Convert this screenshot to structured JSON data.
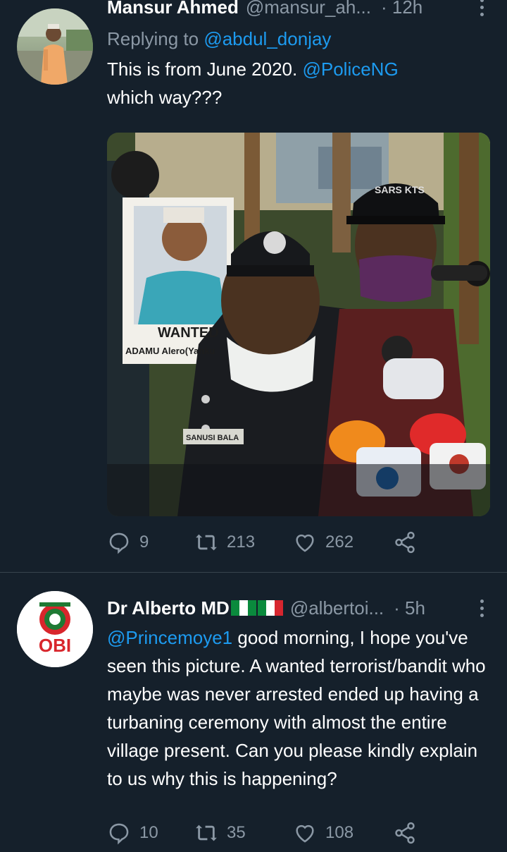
{
  "tweets": [
    {
      "name": "Mansur Ahmed",
      "handle": "@mansur_ah...",
      "time": "· 12h",
      "replying_prefix": "Replying to ",
      "replying_to": "@abdul_donjay",
      "text_before": "This is from June 2020. ",
      "mention": "@PoliceNG",
      "text_after": "which way???",
      "photo_caption_line1": "WANTED",
      "photo_caption_line2": "ADAMU Alero(Yanku",
      "cap_text": "SARS KTS",
      "name_tag": "SANUSI BALA",
      "replies": "9",
      "retweets": "213",
      "likes": "262"
    },
    {
      "name": "Dr Alberto MD",
      "handle": "@albertoi...",
      "time": "· 5h",
      "avatar_text": "OBI",
      "mention": "@Princemoye1",
      "text": " good morning, I hope you've seen this picture. A wanted terrorist/bandit who maybe was never arrested ended up having a turbaning ceremony with almost the entire village present. Can you please kindly explain to us why this is happening?",
      "replies": "10",
      "retweets": "35",
      "likes": "108"
    }
  ],
  "icons": [
    "reply-icon",
    "retweet-icon",
    "like-icon",
    "share-icon",
    "more-icon"
  ],
  "colors": {
    "background": "#15202b",
    "link": "#1d9bf0",
    "muted": "#8b98a5",
    "divider": "#38444d"
  }
}
